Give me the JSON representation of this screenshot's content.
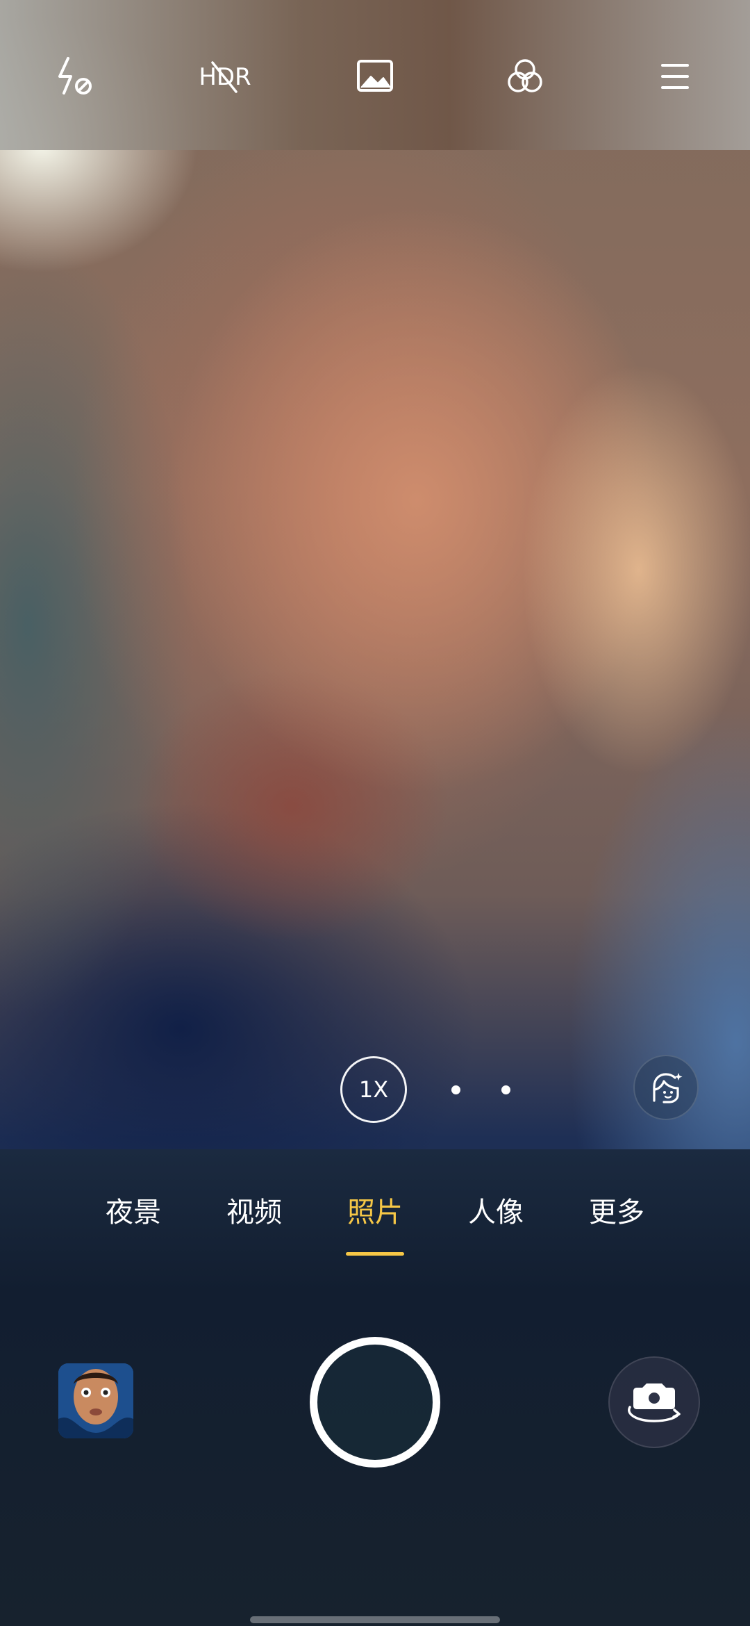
{
  "top_bar": {
    "flash_icon": "flash-off-icon",
    "hdr_icon": "hdr-off-icon",
    "hdr_label": "HDR",
    "picture_icon": "image-icon",
    "filter_icon": "filter-circles-icon",
    "menu_icon": "menu-icon"
  },
  "zoom": {
    "label": "1X"
  },
  "beauty_icon": "face-beauty-icon",
  "modes": [
    {
      "label": "夜景",
      "active": false
    },
    {
      "label": "视频",
      "active": false
    },
    {
      "label": "照片",
      "active": true
    },
    {
      "label": "人像",
      "active": false
    },
    {
      "label": "更多",
      "active": false
    }
  ],
  "controls": {
    "gallery_icon": "gallery-thumbnail",
    "shutter_icon": "shutter-button",
    "switch_icon": "switch-camera-icon"
  },
  "colors": {
    "accent": "#f6c746",
    "text": "#ffffff"
  }
}
